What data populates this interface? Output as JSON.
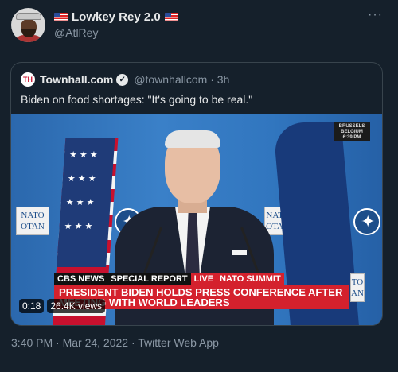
{
  "author": {
    "display_name": "Lowkey Rey 2.0",
    "handle": "@AtlRey"
  },
  "more_label": "···",
  "quoted": {
    "logo_text": "TH",
    "name": "Townhall.com",
    "verified_mark": "✓",
    "handle_time": "@townhallcom · 3h",
    "text": "Biden on food shortages: \"It's going to be real.\""
  },
  "video": {
    "location": [
      "BRUSSELS",
      "BELGIUM",
      "6:39 PM"
    ],
    "sign_left": [
      "NATO",
      "OTAN"
    ],
    "sign_mid": [
      "NATO",
      "OTAN"
    ],
    "sign_right": [
      "TO",
      "AN"
    ],
    "chyron": {
      "network": "CBS NEWS",
      "special": "SPECIAL REPORT",
      "live": "LIVE",
      "topic": "NATO SUMMIT",
      "headline": "PRESIDENT BIDEN HOLDS PRESS CONFERENCE AFTER MEETING WITH WORLD LEADERS"
    },
    "duration": "0:18",
    "views": "26.4K views"
  },
  "timestamp": "3:40 PM · Mar 24, 2022 · Twitter Web App"
}
